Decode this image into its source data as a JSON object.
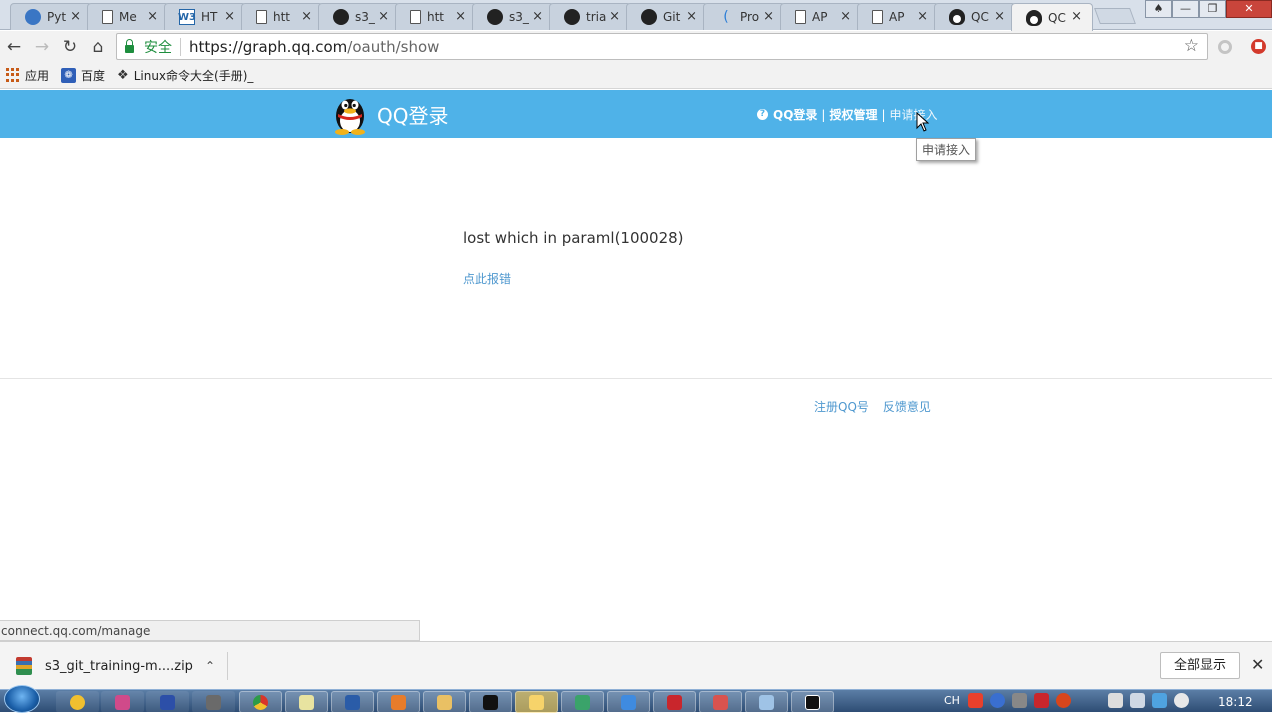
{
  "browser": {
    "tabs": [
      {
        "title": "Pyt",
        "icon": "python-icon",
        "active": false
      },
      {
        "title": "Me",
        "icon": "document-icon",
        "active": false
      },
      {
        "title": "HT",
        "icon": "w3-icon",
        "active": false
      },
      {
        "title": "htt",
        "icon": "document-icon",
        "active": false
      },
      {
        "title": "s3_",
        "icon": "github-icon",
        "active": false
      },
      {
        "title": "htt",
        "icon": "document-icon",
        "active": false
      },
      {
        "title": "s3_",
        "icon": "github-icon",
        "active": false
      },
      {
        "title": "tria",
        "icon": "github-icon",
        "active": false
      },
      {
        "title": "Git",
        "icon": "github-icon",
        "active": false
      },
      {
        "title": "Pro",
        "icon": "process-icon",
        "active": false
      },
      {
        "title": "AP",
        "icon": "document-icon",
        "active": false
      },
      {
        "title": "AP",
        "icon": "document-icon",
        "active": false
      },
      {
        "title": "QC",
        "icon": "qq-penguin-icon",
        "active": false
      },
      {
        "title": "QC",
        "icon": "qq-penguin-icon",
        "active": true
      }
    ],
    "address": {
      "secure_label": "安全",
      "url_host": "https://graph.qq.com",
      "url_path": "/oauth/show"
    },
    "bookmarks": [
      {
        "label": "应用",
        "icon": "apps-grid-icon"
      },
      {
        "label": "百度",
        "icon": "baidu-paw-icon"
      },
      {
        "label": "Linux命令大全(手册)_",
        "icon": "linux-icon"
      }
    ]
  },
  "qq": {
    "brand": "QQ登录",
    "nav": {
      "login": "QQ登录",
      "separator": "|",
      "manage": "授权管理",
      "apply": "申请接入"
    },
    "tooltip": "申请接入",
    "error_message": "lost which in paraml(100028)",
    "report_link": "点此报错",
    "footer": {
      "register": "注册QQ号",
      "feedback": "反馈意见"
    },
    "colors": {
      "header_bg": "#4fb2e8",
      "link": "#4f98cf"
    }
  },
  "status": {
    "hover_url": "connect.qq.com/manage"
  },
  "downloads": {
    "item_name": "s3_git_training-m....zip",
    "show_all": "全部显示"
  },
  "taskbar": {
    "ime": "CH",
    "clock": "18:12"
  }
}
